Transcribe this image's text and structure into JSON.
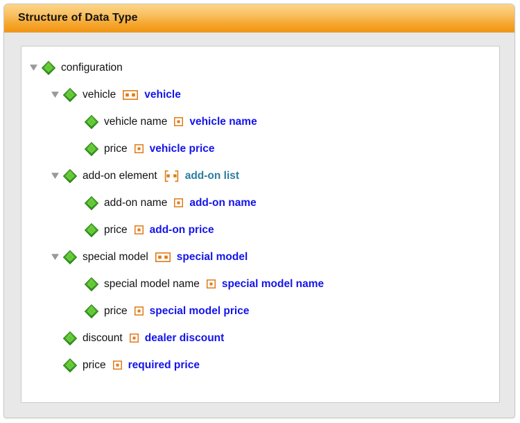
{
  "panel": {
    "title": "Structure of Data Type",
    "accent_color": "#f2960f",
    "header_text_color": "#141414",
    "background_color": "#e8e8e8",
    "tree_background_color": "#ffffff"
  },
  "legend": {
    "node_icon": "green-diamond-icon",
    "expanded_icon": "triangle-down-icon",
    "record_badge": "record-type-icon",
    "list_badge": "list-type-icon",
    "simple_badge": "simple-type-icon",
    "node_color": "#3aa523",
    "badge_color": "#e07b18",
    "mapped_color": "#1414ec",
    "mapped_color_alt": "#2b7d9f"
  },
  "tree": {
    "nodes": [
      {
        "label": "configuration",
        "depth": 0,
        "expandable": true,
        "expanded": true,
        "badge": "none",
        "mapped": "",
        "mapped_style": "none"
      },
      {
        "label": "vehicle",
        "depth": 1,
        "expandable": true,
        "expanded": true,
        "badge": "record",
        "mapped": "vehicle",
        "mapped_style": "blue"
      },
      {
        "label": "vehicle name",
        "depth": 2,
        "expandable": false,
        "expanded": false,
        "badge": "simple",
        "mapped": "vehicle name",
        "mapped_style": "blue"
      },
      {
        "label": "price",
        "depth": 2,
        "expandable": false,
        "expanded": false,
        "badge": "simple",
        "mapped": "vehicle price",
        "mapped_style": "blue"
      },
      {
        "label": "add-on element",
        "depth": 1,
        "expandable": true,
        "expanded": true,
        "badge": "list",
        "mapped": "add-on list",
        "mapped_style": "teal"
      },
      {
        "label": "add-on name",
        "depth": 2,
        "expandable": false,
        "expanded": false,
        "badge": "simple",
        "mapped": "add-on name",
        "mapped_style": "blue"
      },
      {
        "label": "price",
        "depth": 2,
        "expandable": false,
        "expanded": false,
        "badge": "simple",
        "mapped": "add-on price",
        "mapped_style": "blue"
      },
      {
        "label": "special model",
        "depth": 1,
        "expandable": true,
        "expanded": true,
        "badge": "record",
        "mapped": "special model",
        "mapped_style": "blue"
      },
      {
        "label": "special model name",
        "depth": 2,
        "expandable": false,
        "expanded": false,
        "badge": "simple",
        "mapped": "special model name",
        "mapped_style": "blue"
      },
      {
        "label": "price",
        "depth": 2,
        "expandable": false,
        "expanded": false,
        "badge": "simple",
        "mapped": "special model price",
        "mapped_style": "blue"
      },
      {
        "label": "discount",
        "depth": 1,
        "expandable": false,
        "expanded": false,
        "badge": "simple",
        "mapped": "dealer discount",
        "mapped_style": "blue"
      },
      {
        "label": "price",
        "depth": 1,
        "expandable": false,
        "expanded": false,
        "badge": "simple",
        "mapped": "required price",
        "mapped_style": "blue"
      }
    ]
  }
}
